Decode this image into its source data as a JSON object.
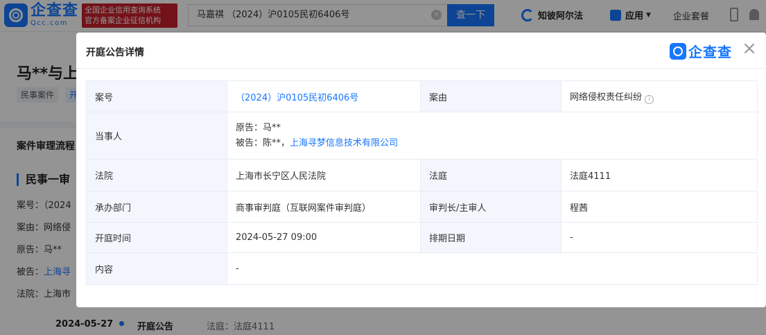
{
  "header": {
    "logo_cn": "企查查",
    "logo_en": "Qcc.com",
    "badge_line1": "全国企业信用查询系统",
    "badge_line2": "官方备案企业征信机构",
    "search_value": "马嘉祺 （2024）沪0105民初6406号",
    "search_button": "查一下",
    "zhibi_label": "知彼阿尔法",
    "apps_label": "应用",
    "plan_label": "企业套餐"
  },
  "background": {
    "title": "马**与上",
    "tag1": "民事案件",
    "tag2": "开",
    "section_title": "案件审理流程",
    "stage_title": "民事一审",
    "case_no": "案号：（2024",
    "cause": "案由：网络侵",
    "plaintiff": "原告：马**",
    "defendant_label": "被告：",
    "defendant_link": "上海寻",
    "court": "法院：上海市",
    "timeline_date": "2024-05-27",
    "timeline_event": "开庭公告",
    "timeline_court": "法庭：法庭4111"
  },
  "modal": {
    "title": "开庭公告详情",
    "logo_text": "企查查",
    "close": "×",
    "rows": {
      "case_no_label": "案号",
      "case_no_value": "（2024）沪0105民初6406号",
      "cause_label": "案由",
      "cause_value": "网络侵权责任纠纷",
      "parties_label": "当事人",
      "plaintiff_text": "原告：马**",
      "defendant_prefix": "被告：陈**，",
      "defendant_link": "上海寻梦信息技术有限公司",
      "court_label": "法院",
      "court_value": "上海市长宁区人民法院",
      "courtroom_label": "法庭",
      "courtroom_value": "法庭4111",
      "dept_label": "承办部门",
      "dept_value": "商事审判庭（互联网案件审判庭）",
      "judge_label": "审判长/主审人",
      "judge_value": "程茜",
      "hearing_time_label": "开庭时间",
      "hearing_time_value": "2024-05-27 09:00",
      "schedule_label": "排期日期",
      "schedule_value": "-",
      "content_label": "内容",
      "content_value": "-"
    }
  },
  "colors": {
    "brand": "#1777ff",
    "badge": "#c8202b",
    "label_bg": "#f3f7fd"
  },
  "icons": [
    "logo-icon",
    "clear-icon",
    "zhibi-icon",
    "apps-icon",
    "chevron-down-icon",
    "phone-icon",
    "bell-icon",
    "close-icon",
    "info-icon"
  ]
}
